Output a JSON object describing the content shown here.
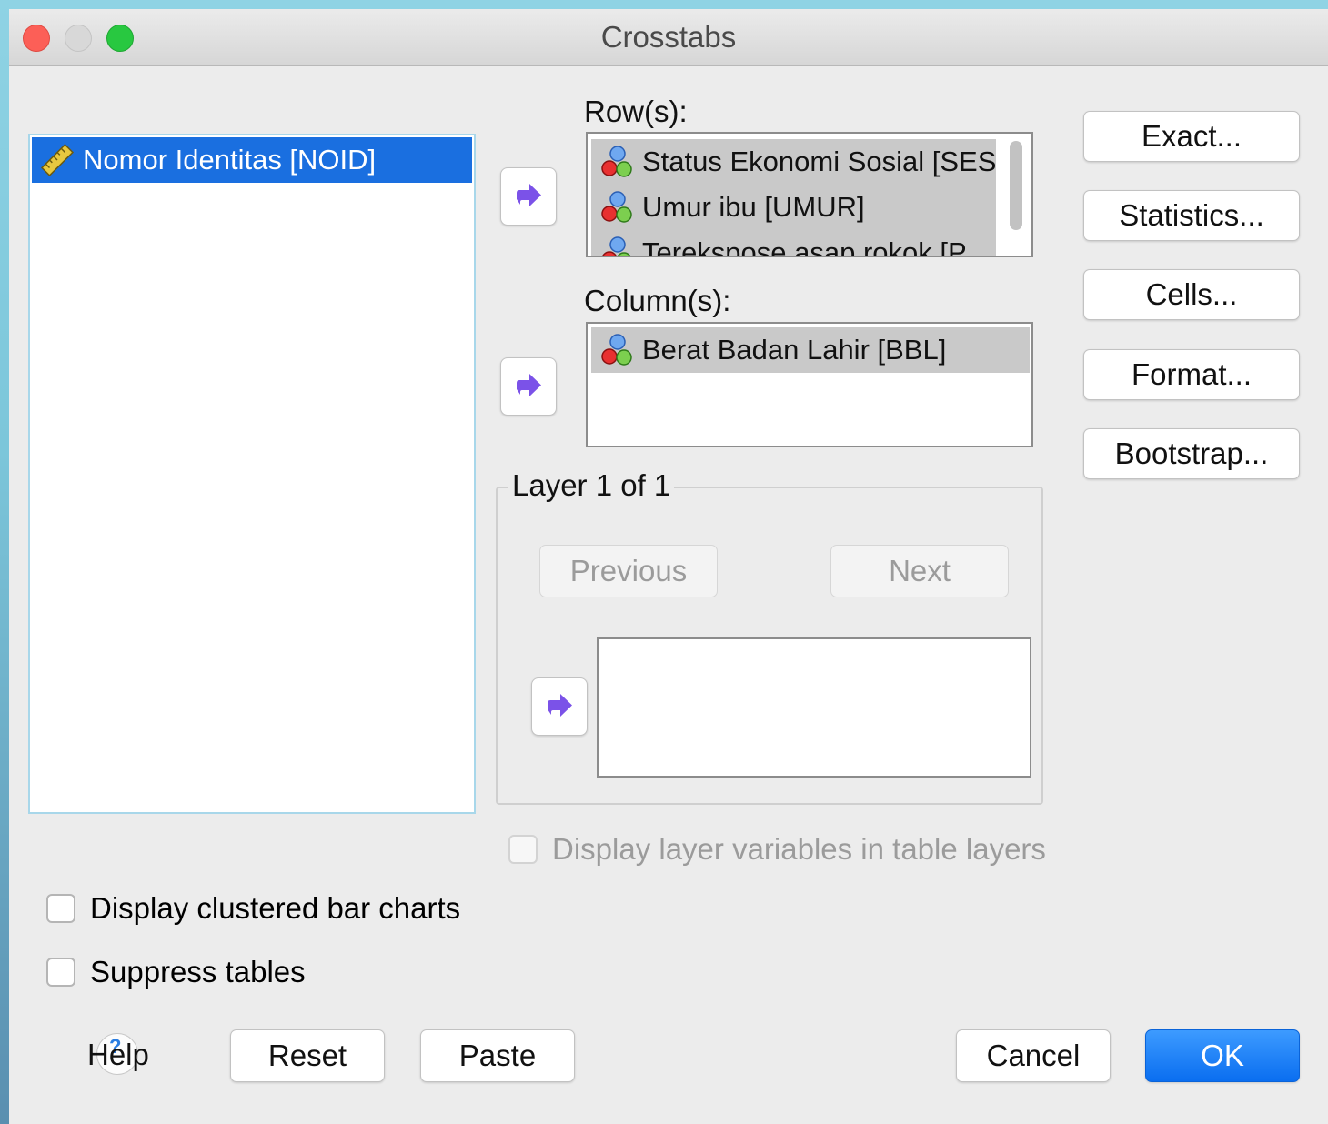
{
  "window": {
    "title": "Crosstabs"
  },
  "source_list": {
    "items": [
      {
        "label": "Nomor Identitas [NOID]",
        "icon": "ruler-icon",
        "selected": true
      }
    ]
  },
  "rows": {
    "label": "Row(s):",
    "items": [
      {
        "label": "Status Ekonomi Sosial [SES]",
        "icon": "nominal-variable-icon"
      },
      {
        "label": "Umur ibu [UMUR]",
        "icon": "nominal-variable-icon"
      },
      {
        "label": "Terekspose asap rokok [P",
        "icon": "nominal-variable-icon"
      }
    ]
  },
  "columns": {
    "label": "Column(s):",
    "items": [
      {
        "label": "Berat Badan Lahir [BBL]",
        "icon": "nominal-variable-icon"
      }
    ]
  },
  "side_buttons": {
    "exact": "Exact...",
    "statistics": "Statistics...",
    "cells": "Cells...",
    "format": "Format...",
    "bootstrap": "Bootstrap..."
  },
  "layer": {
    "legend": "Layer 1 of 1",
    "previous": "Previous",
    "next": "Next"
  },
  "options": {
    "display_layer_vars": "Display layer variables in table layers",
    "clustered_bar": "Display clustered bar charts",
    "suppress_tables": "Suppress tables"
  },
  "footer": {
    "help": "Help",
    "reset": "Reset",
    "paste": "Paste",
    "cancel": "Cancel",
    "ok": "OK"
  },
  "colors": {
    "accent": "#1a6fe0",
    "arrow": "#7b52e8"
  }
}
